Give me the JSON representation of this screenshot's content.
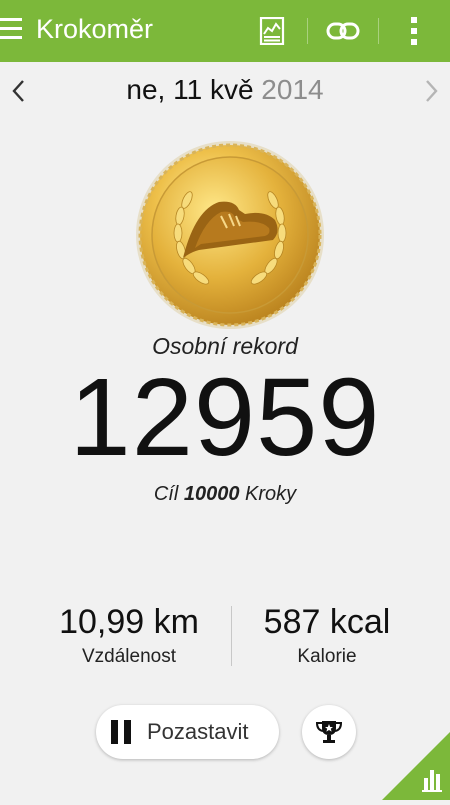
{
  "appbar": {
    "title": "Krokoměr",
    "icons": [
      "menu-icon",
      "chart-report-icon",
      "link-icon",
      "overflow-menu-icon"
    ],
    "color": "#7cb83a"
  },
  "date": {
    "day": "ne, 11 kvě",
    "year": "2014",
    "prev_icon": "chevron-left-icon",
    "next_icon": "chevron-right-icon"
  },
  "medal": {
    "icon": "gold-medal-shoe-icon",
    "color": "#d9a92c"
  },
  "record": {
    "label": "Osobní rekord",
    "steps": "12959",
    "goal_prefix": "Cíl",
    "goal_value": "10000",
    "goal_suffix": "Kroky"
  },
  "stats": {
    "distance_value": "10,99 km",
    "distance_label": "Vzdálenost",
    "calories_value": "587 kcal",
    "calories_label": "Kalorie"
  },
  "actions": {
    "pause_label": "Pozastavit",
    "pause_icon": "pause-icon",
    "trophy_icon": "trophy-icon",
    "corner_icon": "bar-chart-icon"
  }
}
